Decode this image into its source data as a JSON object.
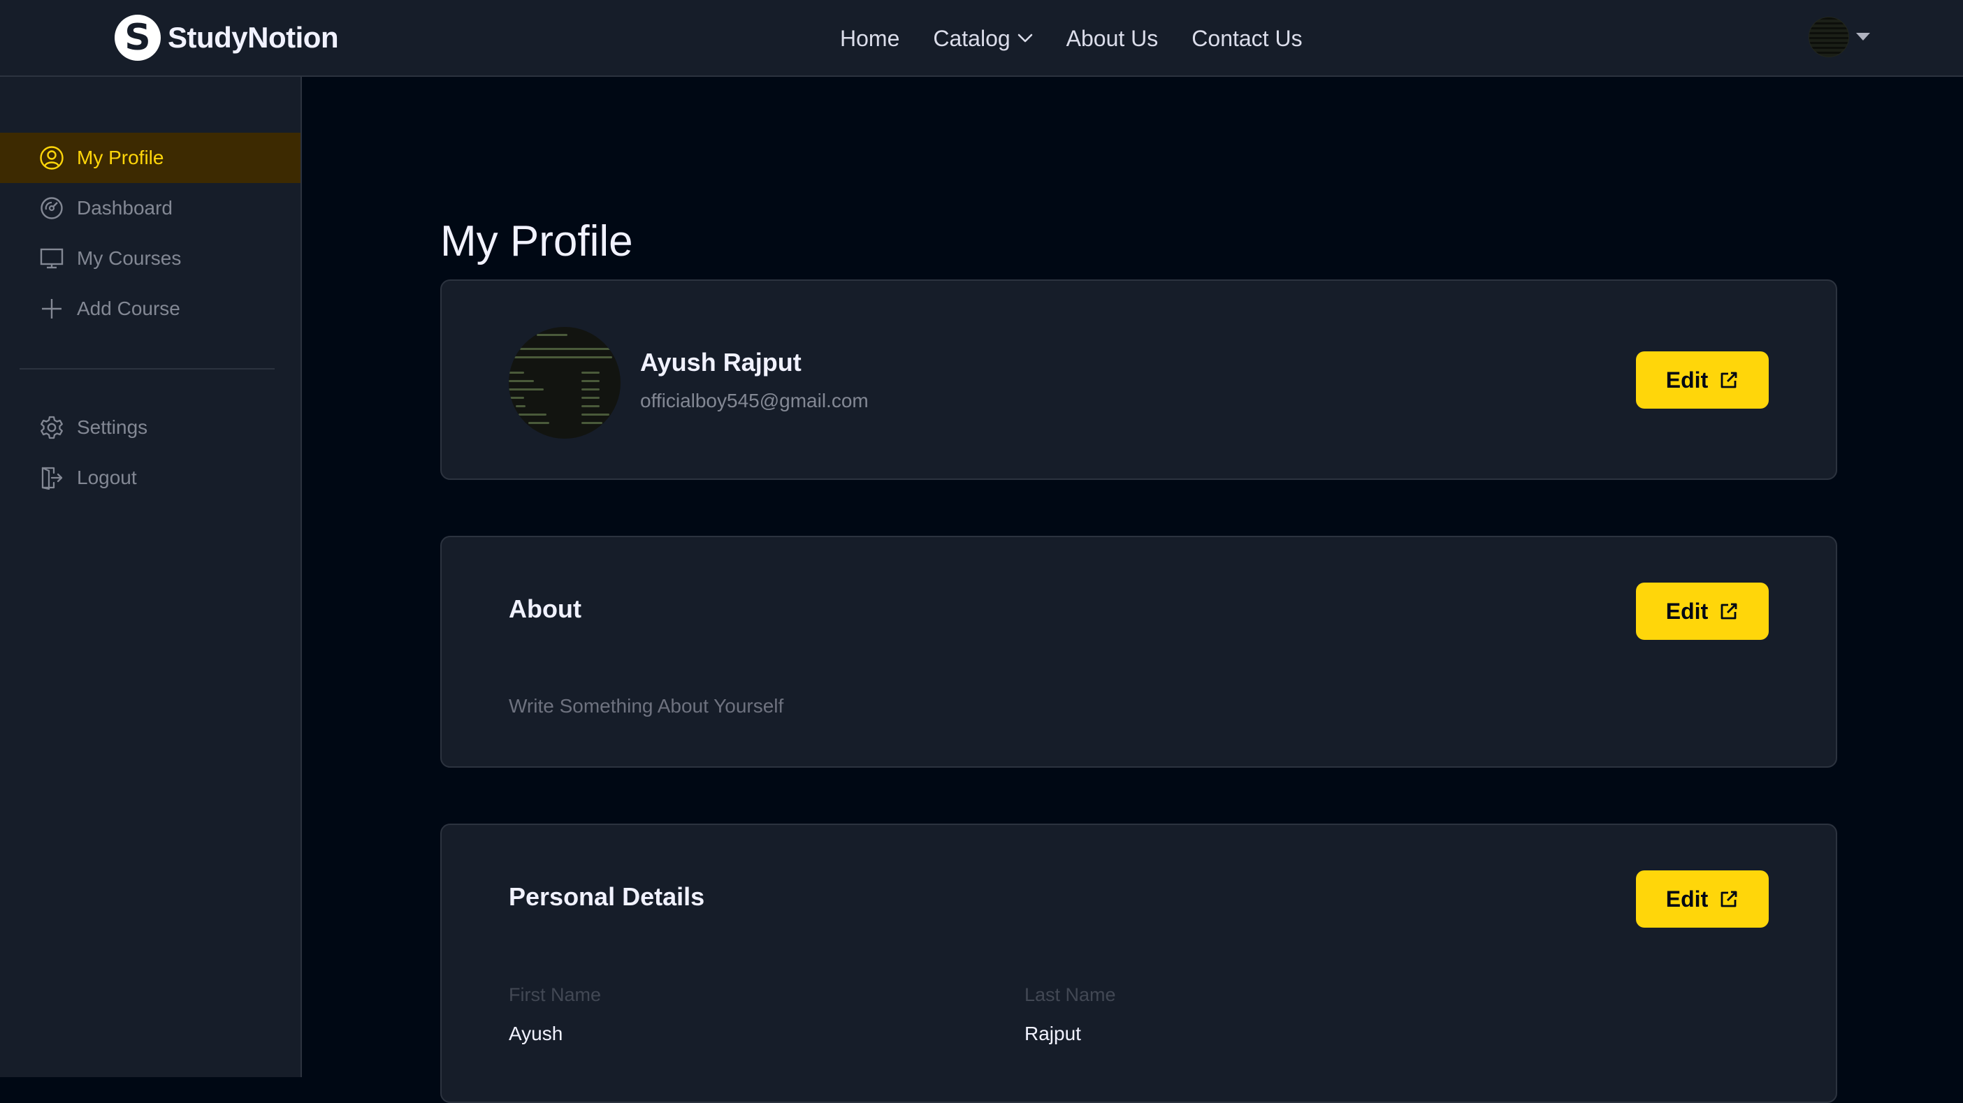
{
  "brand": {
    "logo_letter": "S",
    "name": "StudyNotion"
  },
  "nav": {
    "links": [
      "Home",
      "Catalog",
      "About Us",
      "Contact Us"
    ]
  },
  "sidebar": {
    "items": [
      {
        "label": "My Profile",
        "icon": "user-circle-icon",
        "active": true
      },
      {
        "label": "Dashboard",
        "icon": "gauge-icon",
        "active": false
      },
      {
        "label": "My Courses",
        "icon": "monitor-icon",
        "active": false
      },
      {
        "label": "Add Course",
        "icon": "plus-icon",
        "active": false
      }
    ],
    "footer_items": [
      {
        "label": "Settings",
        "icon": "gear-icon"
      },
      {
        "label": "Logout",
        "icon": "logout-icon"
      }
    ]
  },
  "page": {
    "title": "My Profile"
  },
  "profile": {
    "name": "Ayush Rajput",
    "email": "officialboy545@gmail.com",
    "edit_label": "Edit"
  },
  "about": {
    "title": "About",
    "text": "Write Something About Yourself",
    "edit_label": "Edit"
  },
  "personal": {
    "title": "Personal Details",
    "edit_label": "Edit",
    "first_name_label": "First Name",
    "first_name": "Ayush",
    "last_name_label": "Last Name",
    "last_name": "Rajput"
  },
  "colors": {
    "accent": "#FFD60A",
    "active_bg": "#3D2A01",
    "card_bg": "#161D29",
    "page_bg": "#000814"
  }
}
